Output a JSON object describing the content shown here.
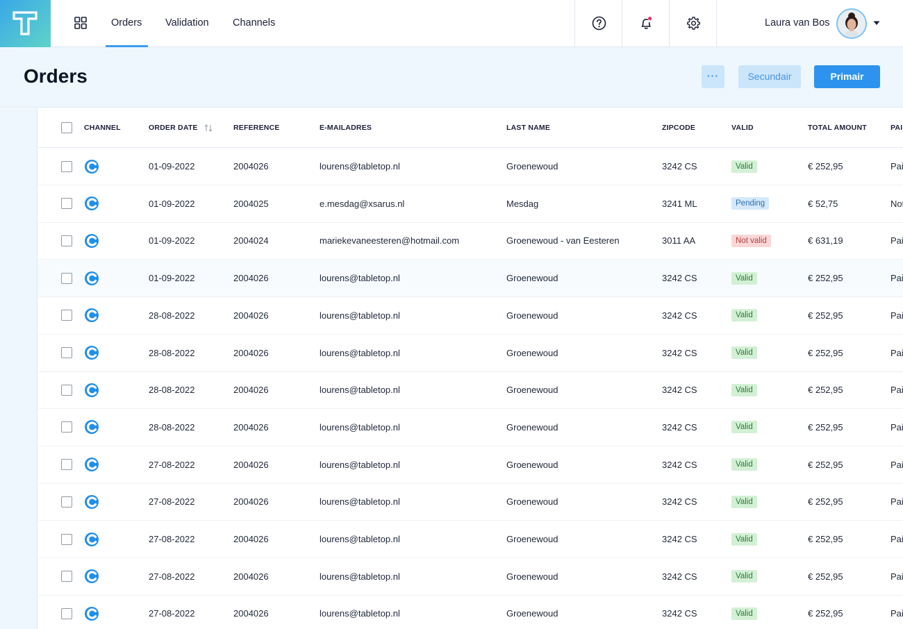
{
  "nav": {
    "logo_letter": "T",
    "tabs": [
      {
        "label": "Orders",
        "active": true
      },
      {
        "label": "Validation",
        "active": false
      },
      {
        "label": "Channels",
        "active": false
      }
    ],
    "icons": [
      "help-icon",
      "notification-bell-icon",
      "settings-gear-icon"
    ],
    "notification_dot_color": "#e8336d",
    "user": {
      "name": "Laura van Bos"
    }
  },
  "header": {
    "title": "Orders",
    "more_label": "···",
    "secondary_label": "Secundair",
    "primary_label": "Primair"
  },
  "colors": {
    "accent": "#2d93ee",
    "valid": "#d3f0d5",
    "pending": "#d5e9fb",
    "not_valid": "#fbd6d6"
  },
  "table": {
    "columns": [
      "Channel",
      "Order date",
      "Reference",
      "E-mailadres",
      "Last name",
      "Zipcode",
      "Valid",
      "Total amount",
      "Pai"
    ],
    "channel_icon": "channel-logo-icon",
    "rows": [
      {
        "date": "01-09-2022",
        "reference": "2004026",
        "email": "lourens@tabletop.nl",
        "last_name": "Groenewoud",
        "zipcode": "3242 CS",
        "valid": "Valid",
        "total": "€ 252,95",
        "paid": "Pai"
      },
      {
        "date": "01-09-2022",
        "reference": "2004025",
        "email": "e.mesdag@xsarus.nl",
        "last_name": "Mesdag",
        "zipcode": "3241 ML",
        "valid": "Pending",
        "total": "€ 52,75",
        "paid": "Not"
      },
      {
        "date": "01-09-2022",
        "reference": "2004024",
        "email": "mariekevaneesteren@hotmail.com",
        "last_name": "Groenewoud - van Eesteren",
        "zipcode": "3011 AA",
        "valid": "Not valid",
        "total": "€ 631,19",
        "paid": "Pai"
      },
      {
        "date": "01-09-2022",
        "reference": "2004026",
        "email": "lourens@tabletop.nl",
        "last_name": "Groenewoud",
        "zipcode": "3242 CS",
        "valid": "Valid",
        "total": "€ 252,95",
        "paid": "Pai"
      },
      {
        "date": "28-08-2022",
        "reference": "2004026",
        "email": "lourens@tabletop.nl",
        "last_name": "Groenewoud",
        "zipcode": "3242 CS",
        "valid": "Valid",
        "total": "€ 252,95",
        "paid": "Pai"
      },
      {
        "date": "28-08-2022",
        "reference": "2004026",
        "email": "lourens@tabletop.nl",
        "last_name": "Groenewoud",
        "zipcode": "3242 CS",
        "valid": "Valid",
        "total": "€ 252,95",
        "paid": "Pai"
      },
      {
        "date": "28-08-2022",
        "reference": "2004026",
        "email": "lourens@tabletop.nl",
        "last_name": "Groenewoud",
        "zipcode": "3242 CS",
        "valid": "Valid",
        "total": "€ 252,95",
        "paid": "Pai"
      },
      {
        "date": "28-08-2022",
        "reference": "2004026",
        "email": "lourens@tabletop.nl",
        "last_name": "Groenewoud",
        "zipcode": "3242 CS",
        "valid": "Valid",
        "total": "€ 252,95",
        "paid": "Pai"
      },
      {
        "date": "27-08-2022",
        "reference": "2004026",
        "email": "lourens@tabletop.nl",
        "last_name": "Groenewoud",
        "zipcode": "3242 CS",
        "valid": "Valid",
        "total": "€ 252,95",
        "paid": "Pai"
      },
      {
        "date": "27-08-2022",
        "reference": "2004026",
        "email": "lourens@tabletop.nl",
        "last_name": "Groenewoud",
        "zipcode": "3242 CS",
        "valid": "Valid",
        "total": "€ 252,95",
        "paid": "Pai"
      },
      {
        "date": "27-08-2022",
        "reference": "2004026",
        "email": "lourens@tabletop.nl",
        "last_name": "Groenewoud",
        "zipcode": "3242 CS",
        "valid": "Valid",
        "total": "€ 252,95",
        "paid": "Pai"
      },
      {
        "date": "27-08-2022",
        "reference": "2004026",
        "email": "lourens@tabletop.nl",
        "last_name": "Groenewoud",
        "zipcode": "3242 CS",
        "valid": "Valid",
        "total": "€ 252,95",
        "paid": "Pai"
      },
      {
        "date": "27-08-2022",
        "reference": "2004026",
        "email": "lourens@tabletop.nl",
        "last_name": "Groenewoud",
        "zipcode": "3242 CS",
        "valid": "Valid",
        "total": "€ 252,95",
        "paid": "Pai"
      }
    ]
  }
}
